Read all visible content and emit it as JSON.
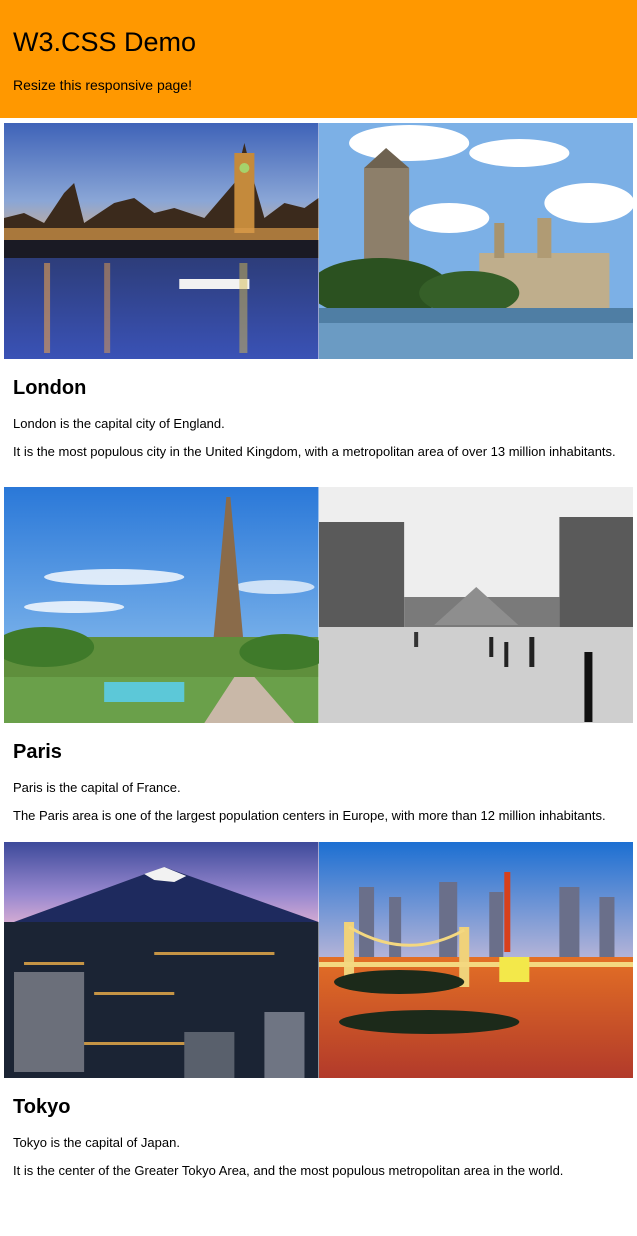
{
  "header": {
    "title": "W3.CSS Demo",
    "subtitle": "Resize this responsive page!",
    "color": "#ff9800"
  },
  "cities": [
    {
      "name": "London",
      "p1": "London is the capital city of England.",
      "p2": "It is the most populous city in the United Kingdom, with a metropolitan area of over 13 million inhabitants.",
      "photos": [
        "london-night-photo",
        "westminster-day-photo"
      ]
    },
    {
      "name": "Paris",
      "p1": "Paris is the capital of France.",
      "p2": "The Paris area is one of the largest population centers in Europe, with more than 12 million inhabitants.",
      "photos": [
        "eiffel-tower-photo",
        "louvre-pyramid-photo"
      ]
    },
    {
      "name": "Tokyo",
      "p1": "Tokyo is the capital of Japan.",
      "p2": "It is the center of the Greater Tokyo Area, and the most populous metropolitan area in the world.",
      "photos": [
        "mount-fuji-city-photo",
        "rainbow-bridge-photo"
      ]
    }
  ]
}
